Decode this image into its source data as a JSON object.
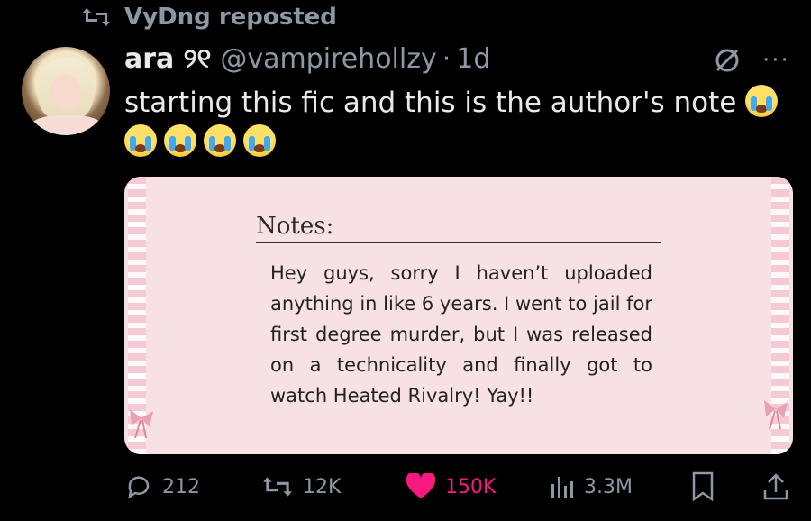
{
  "repost": {
    "label": "VyDng reposted"
  },
  "author": {
    "name": "ara ୨୧",
    "handle": "@vampirehollzy",
    "time": "1d"
  },
  "tweet": {
    "text": "starting this fic and this is the author's note"
  },
  "emojis": [
    "loudly-crying-face",
    "loudly-crying-face",
    "loudly-crying-face",
    "loudly-crying-face",
    "loudly-crying-face"
  ],
  "media": {
    "title": "Notes:",
    "body": "Hey guys, sorry I haven’t uploaded anything in like 6 years. I went to jail for first degree murder, but I was released on a technicality and finally got to watch Heated Rivalry! Yay!!"
  },
  "actions": {
    "replies": "212",
    "reposts": "12K",
    "likes": "150K",
    "views": "3.3M"
  },
  "colors": {
    "background": "#000000",
    "muted": "#8b98a5",
    "like": "#f91880",
    "card": "#f8e1e5"
  }
}
